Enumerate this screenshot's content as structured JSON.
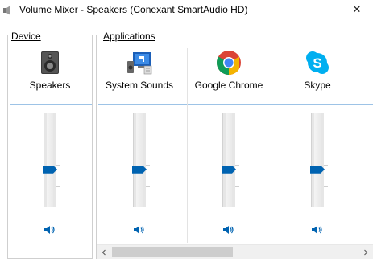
{
  "window": {
    "title": "Volume Mixer - Speakers (Conexant SmartAudio HD)",
    "close_glyph": "✕"
  },
  "groups": {
    "device_label": "Device",
    "applications_label": "Applications"
  },
  "device": {
    "label": "Speakers",
    "icon": "speakers-icon",
    "volume_fraction": 0.4
  },
  "applications": [
    {
      "label": "System Sounds",
      "icon": "system-sounds-icon",
      "volume_fraction": 0.4
    },
    {
      "label": "Google Chrome",
      "icon": "chrome-icon",
      "volume_fraction": 0.4
    },
    {
      "label": "Skype",
      "icon": "skype-icon",
      "volume_fraction": 0.4
    }
  ],
  "colors": {
    "accent": "#0063b1",
    "chrome_red": "#db4437",
    "chrome_green": "#0f9d58",
    "chrome_yellow": "#f4b400",
    "chrome_blue": "#4285f4",
    "skype_blue": "#00aff0"
  }
}
